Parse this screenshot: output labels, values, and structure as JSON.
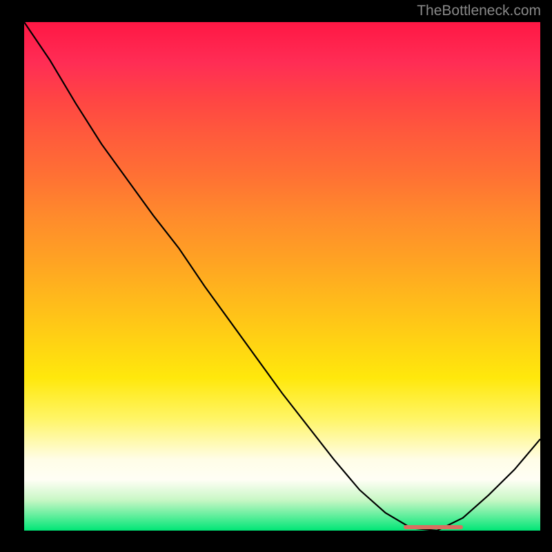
{
  "watermark": "TheBottleneck.com",
  "chart_data": {
    "type": "line",
    "title": "",
    "xlabel": "",
    "ylabel": "",
    "xlim": [
      0,
      100
    ],
    "ylim": [
      0,
      100
    ],
    "grid": false,
    "legend": false,
    "series": [
      {
        "name": "bottleneck-curve",
        "x": [
          0.0,
          5,
          10,
          15,
          20,
          25,
          30,
          35,
          40,
          45,
          50,
          55,
          60,
          65,
          70,
          75,
          80,
          85,
          90,
          95,
          100
        ],
        "values": [
          100,
          92.5,
          84,
          76,
          69,
          62,
          55.5,
          48,
          41,
          34,
          27,
          20.5,
          14,
          8,
          3.5,
          0.5,
          0,
          2.5,
          7,
          12,
          18
        ]
      }
    ],
    "annotations": [
      {
        "name": "optimal-zone",
        "x_start": 73.5,
        "x_end": 85,
        "y": 0.7
      }
    ],
    "gradient_stops": [
      {
        "pos": 0,
        "color": "#ff1744"
      },
      {
        "pos": 50,
        "color": "#ffb81c"
      },
      {
        "pos": 80,
        "color": "#fffde7"
      },
      {
        "pos": 100,
        "color": "#00e676"
      }
    ]
  }
}
